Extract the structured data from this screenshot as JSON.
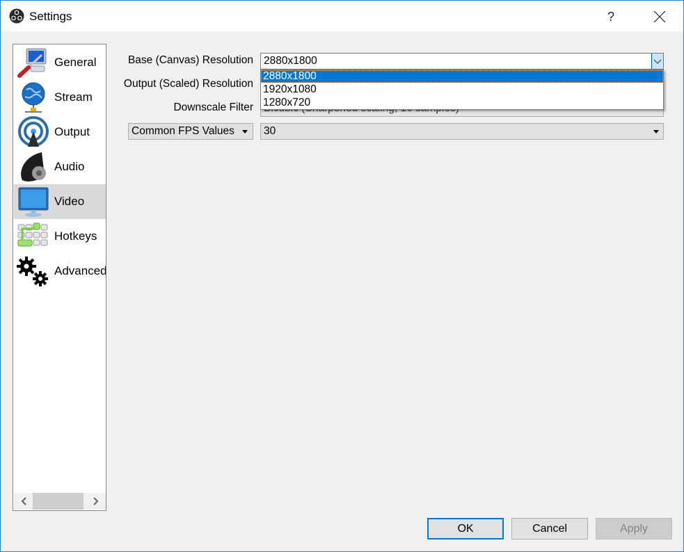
{
  "window": {
    "title": "Settings",
    "help_label": "?",
    "close_icon": "close-icon",
    "app_icon": "obs-logo-icon"
  },
  "sidebar": {
    "selected": "Video",
    "items": [
      {
        "label": "General",
        "icon": "general-wrench-monitor-icon"
      },
      {
        "label": "Stream",
        "icon": "globe-network-icon"
      },
      {
        "label": "Output",
        "icon": "broadcast-antenna-icon"
      },
      {
        "label": "Audio",
        "icon": "speaker-icon"
      },
      {
        "label": "Video",
        "icon": "monitor-icon"
      },
      {
        "label": "Hotkeys",
        "icon": "keyboard-icon"
      },
      {
        "label": "Advanced",
        "icon": "gears-icon"
      }
    ],
    "scrollbar": {
      "left_icon": "chevron-left-icon",
      "right_icon": "chevron-right-icon"
    }
  },
  "video": {
    "base_resolution": {
      "label": "Base (Canvas) Resolution",
      "value": "2880x1800"
    },
    "output_resolution": {
      "label": "Output (Scaled) Resolution",
      "value": ""
    },
    "downscale_filter": {
      "label": "Downscale Filter",
      "value": "Bicubic (Sharpened scaling, 16 samples)"
    },
    "fps": {
      "mode_label": "Common FPS Values",
      "value": "30"
    },
    "dropdown_options": [
      "2880x1800",
      "1920x1080",
      "1280x720"
    ],
    "dropdown_highlighted": "2880x1800"
  },
  "buttons": {
    "ok": "OK",
    "cancel": "Cancel",
    "apply": "Apply"
  },
  "colors": {
    "accent": "#0078d7",
    "window_border": "#1883d7",
    "selection_bg": "#0078d7"
  }
}
